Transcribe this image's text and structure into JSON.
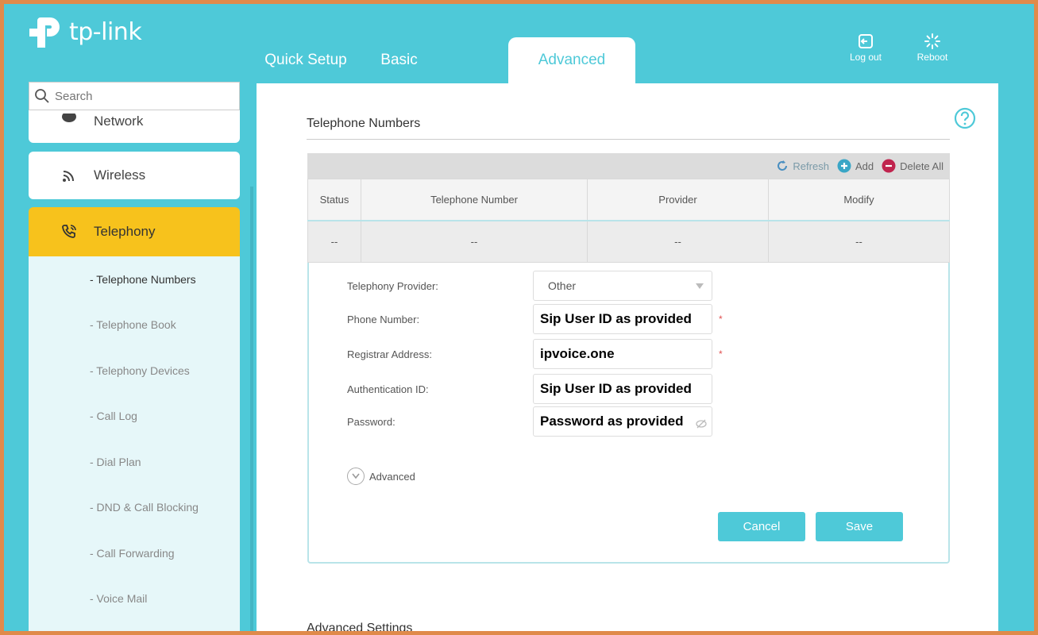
{
  "brand": {
    "name": "tp-link",
    "color": "#4ec9d8",
    "accent": "#f7c21c"
  },
  "tabs": [
    {
      "label": "Quick Setup"
    },
    {
      "label": "Basic"
    },
    {
      "label": "Advanced"
    }
  ],
  "header": {
    "logout_label": "Log out",
    "reboot_label": "Reboot"
  },
  "search": {
    "placeholder": "Search"
  },
  "sidebar": {
    "sections": [
      {
        "label": "Network",
        "icon": "globe-icon"
      },
      {
        "label": "Wireless",
        "icon": "wifi-icon"
      },
      {
        "label": "Telephony",
        "icon": "phone-icon",
        "active": true
      }
    ],
    "submenu": [
      {
        "label": "- Telephone Numbers",
        "active": true
      },
      {
        "label": "- Telephone Book"
      },
      {
        "label": "- Telephony Devices"
      },
      {
        "label": "- Call Log"
      },
      {
        "label": "- Dial Plan"
      },
      {
        "label": "- DND & Call Blocking"
      },
      {
        "label": "- Call Forwarding"
      },
      {
        "label": "- Voice Mail"
      }
    ]
  },
  "content": {
    "section_title": "Telephone Numbers",
    "toolbar": {
      "refresh": "Refresh",
      "add": "Add",
      "delete_all": "Delete All"
    },
    "table": {
      "columns": [
        "Status",
        "Telephone Number",
        "Provider",
        "Modify"
      ],
      "rows": [
        [
          "--",
          "--",
          "--",
          "--"
        ]
      ]
    },
    "form": {
      "provider_label": "Telephony Provider:",
      "provider_value": "Other",
      "phone_label": "Phone Number:",
      "phone_value": "Sip User ID as provided",
      "registrar_label": "Registrar Address:",
      "registrar_value": "ipvoice.one",
      "auth_label": "Authentication ID:",
      "auth_value": "Sip User ID as provided",
      "password_label": "Password:",
      "password_value": "Password as provided",
      "required_mark": "*",
      "advanced_label": "Advanced"
    },
    "buttons": {
      "cancel": "Cancel",
      "save": "Save"
    },
    "advanced_settings_title": "Advanced Settings"
  }
}
